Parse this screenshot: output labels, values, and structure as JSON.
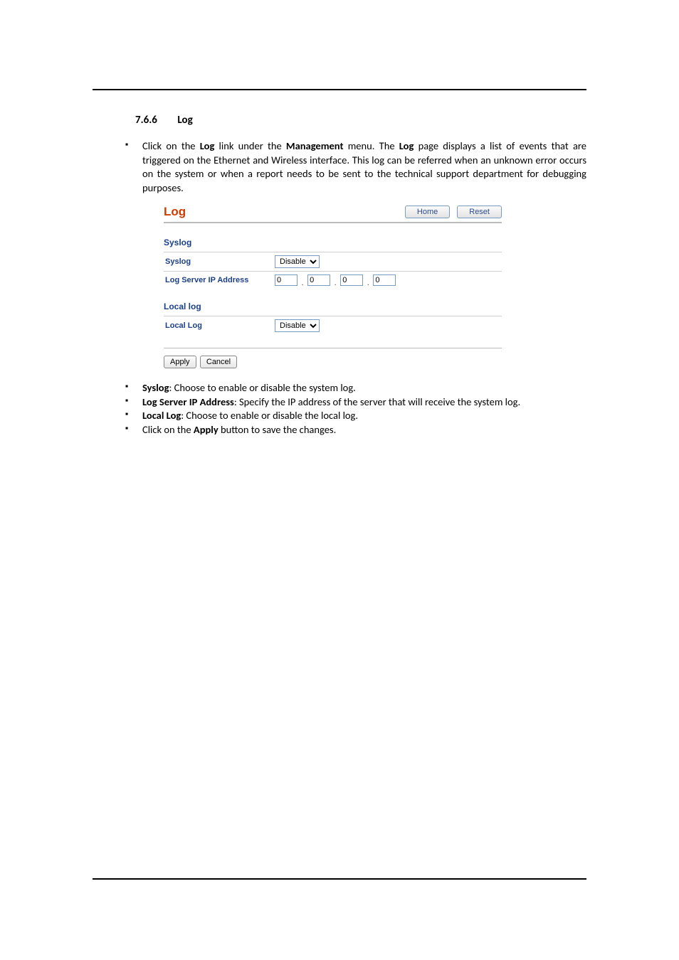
{
  "section": {
    "number": "7.6.6",
    "title": "Log"
  },
  "intro": {
    "pre": "Click on the ",
    "link": "Log",
    "mid1": " link under the ",
    "menu": "Management",
    "mid2": " menu. The ",
    "page": "Log",
    "post": " page displays a list of events that are triggered on the Ethernet and Wireless interface. This log can be referred when an unknown error occurs on the system or when a report needs to be sent to the technical support department for debugging purposes."
  },
  "panel": {
    "title": "Log",
    "home_btn": "Home",
    "reset_btn": "Reset",
    "syslog_section": "Syslog",
    "syslog_label": "Syslog",
    "syslog_value": "Disable",
    "ip_label": "Log Server IP Address",
    "ip": [
      "0",
      "0",
      "0",
      "0"
    ],
    "local_section": "Local log",
    "local_label": "Local Log",
    "local_value": "Disable",
    "apply_btn": "Apply",
    "cancel_btn": "Cancel"
  },
  "notes": {
    "n1": {
      "b": "Syslog",
      "t": ": Choose to enable or disable the system log."
    },
    "n2": {
      "b": "Log Server IP Address",
      "t": ": Specify the IP address of the server that will receive the system log."
    },
    "n3": {
      "b": "Local Log",
      "t": ": Choose to enable or disable the local log."
    },
    "n4": {
      "pre": "Click on the ",
      "b": "Apply",
      "t": " button to save the changes."
    }
  }
}
